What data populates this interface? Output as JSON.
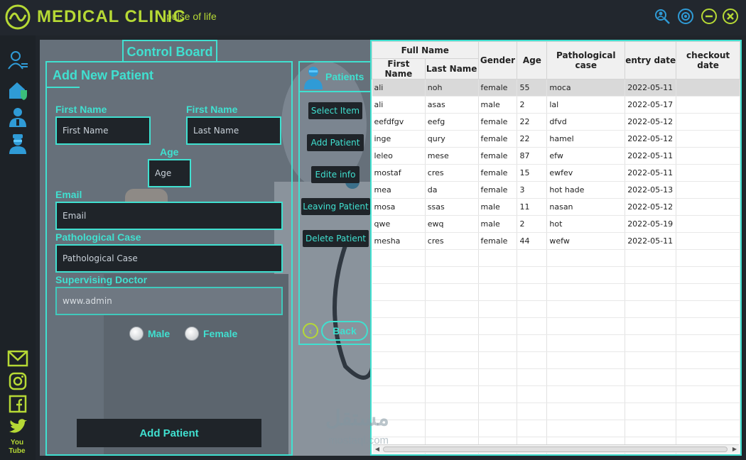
{
  "header": {
    "title": "MEDICAL CLINIC",
    "tagline": "pulse of life",
    "accent": "#b6d935",
    "icons": [
      "logo-icon",
      "search-user-icon",
      "settings-icon",
      "minimize-icon",
      "close-icon"
    ]
  },
  "sidebar": {
    "top_icons": [
      "user-list-icon",
      "home-shield-icon",
      "doctor-icon",
      "nurse-icon"
    ],
    "bottom_icons": [
      "mail-icon",
      "instagram-icon",
      "facebook-icon",
      "twitter-icon",
      "youtube-icon"
    ],
    "youtube_text": "You Tube"
  },
  "section_tab": "Control Board",
  "form": {
    "title": "Add New Patient",
    "first_name_label": "First Name",
    "first_name_placeholder": "First Name",
    "last_name_label": "First Name",
    "last_name_placeholder": "Last Name",
    "age_label": "Age",
    "age_placeholder": "Age",
    "email_label": "Email",
    "email_placeholder": "Email",
    "pathological_label": "Pathological Case",
    "pathological_placeholder": "Pathological Case",
    "doctor_label": "Supervising Doctor",
    "doctor_value": "www.admin",
    "gender_male": "Male",
    "gender_female": "Female",
    "submit_label": "Add Patient"
  },
  "actions": {
    "header": "Patients",
    "buttons": [
      "Select Item",
      "Add Patient",
      "Edite info",
      "Leaving Patient",
      "Delete Patient"
    ],
    "back_label": "Back"
  },
  "table": {
    "group_header": "Full Name",
    "columns": [
      "First Name",
      "Last Name",
      "Gender",
      "Age",
      "Pathological case",
      "entry date",
      "checkout date"
    ],
    "rows": [
      [
        "ali",
        "noh",
        "female",
        "55",
        "moca",
        "2022-05-11",
        ""
      ],
      [
        "ali",
        "asas",
        "male",
        "2",
        "lal",
        "2022-05-17",
        ""
      ],
      [
        "eefdfgv",
        "eefg",
        "female",
        "22",
        "dfvd",
        "2022-05-12",
        ""
      ],
      [
        "inge",
        "qury",
        "female",
        "22",
        "hamel",
        "2022-05-12",
        ""
      ],
      [
        "leleo",
        "mese",
        "female",
        "87",
        "efw",
        "2022-05-11",
        ""
      ],
      [
        "mostaf",
        "cres",
        "female",
        "15",
        "ewfev",
        "2022-05-11",
        ""
      ],
      [
        "mea",
        "da",
        "female",
        "3",
        "hot hade",
        "2022-05-13",
        ""
      ],
      [
        "mosa",
        "ssas",
        "male",
        "11",
        "nasan",
        "2022-05-12",
        ""
      ],
      [
        "qwe",
        "ewq",
        "male",
        "2",
        "hot",
        "2022-05-19",
        ""
      ],
      [
        "mesha",
        "cres",
        "female",
        "44",
        "wefw",
        "2022-05-11",
        ""
      ]
    ],
    "selected_row": 0,
    "empty_rows": 12
  },
  "watermark": {
    "text": "مستقل",
    "sub": "mostaql.com"
  }
}
